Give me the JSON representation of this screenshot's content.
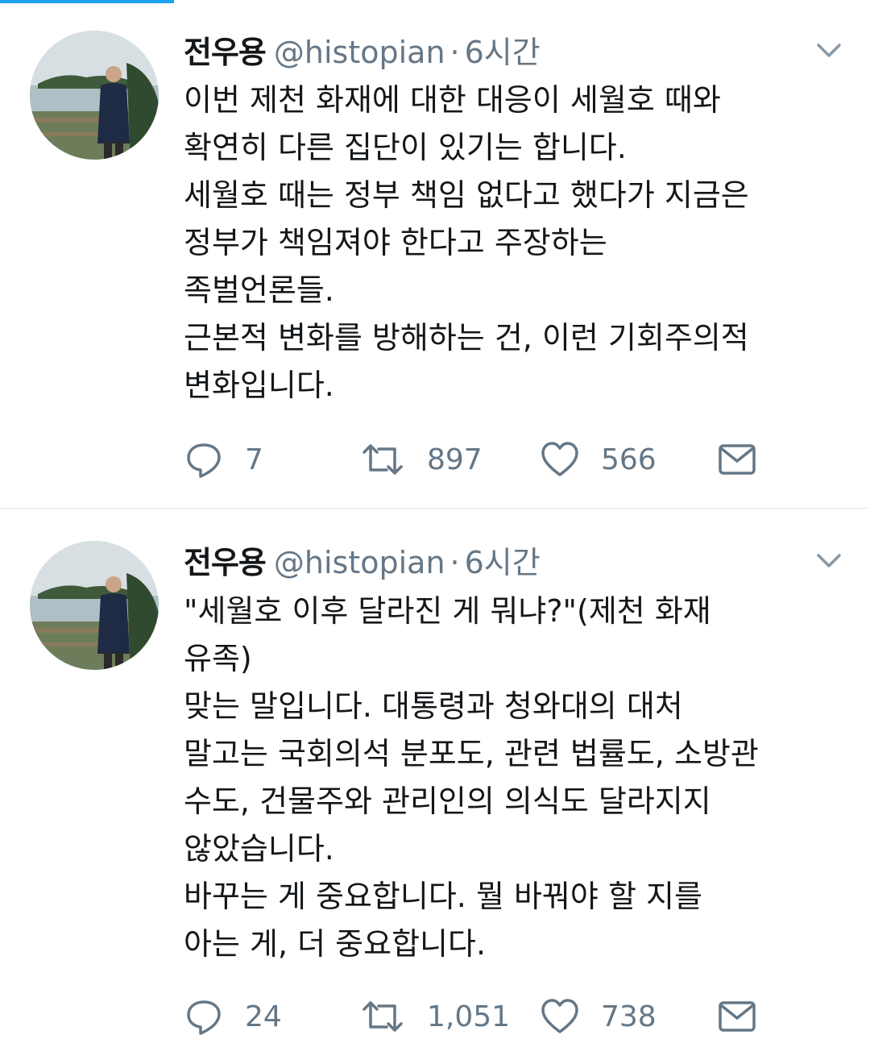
{
  "progress": {
    "fraction": 0.2,
    "color": "#1da1f2"
  },
  "tweets": [
    {
      "author_name": "전우용",
      "handle": "@histopian",
      "separator": "·",
      "time": "6시간",
      "body_lines": [
        "이번 제천 화재에 대한 대응이 세월호 때와",
        "확연히 다른 집단이 있기는 합니다.",
        "세월호 때는 정부 책임 없다고 했다가 지금은",
        "정부가 책임져야 한다고 주장하는",
        "족벌언론들.",
        "근본적 변화를 방해하는 건, 이런 기회주의적",
        "변화입니다."
      ],
      "replies": "7",
      "retweets": "897",
      "likes": "566"
    },
    {
      "author_name": "전우용",
      "handle": "@histopian",
      "separator": "·",
      "time": "6시간",
      "body_lines": [
        "\"세월호 이후 달라진 게 뭐냐?\"(제천 화재",
        "유족)",
        "맞는 말입니다. 대통령과 청와대의 대처",
        "말고는 국회의석 분포도, 관련 법률도, 소방관",
        "수도, 건물주와 관리인의 의식도 달라지지",
        "않았습니다.",
        "바꾸는 게 중요합니다. 뭘 바꿔야 할 지를",
        "아는 게, 더 중요합니다."
      ],
      "replies": "24",
      "retweets": "1,051",
      "likes": "738"
    }
  ],
  "icons": {
    "avatar": "avatar-photo",
    "menu": "chevron-down-icon",
    "reply": "reply-icon",
    "retweet": "retweet-icon",
    "like": "heart-icon",
    "dm": "envelope-icon"
  },
  "colors": {
    "icon": "#657786",
    "text": "#14171a",
    "secondary": "#657786",
    "divider": "#e1e8ed"
  }
}
